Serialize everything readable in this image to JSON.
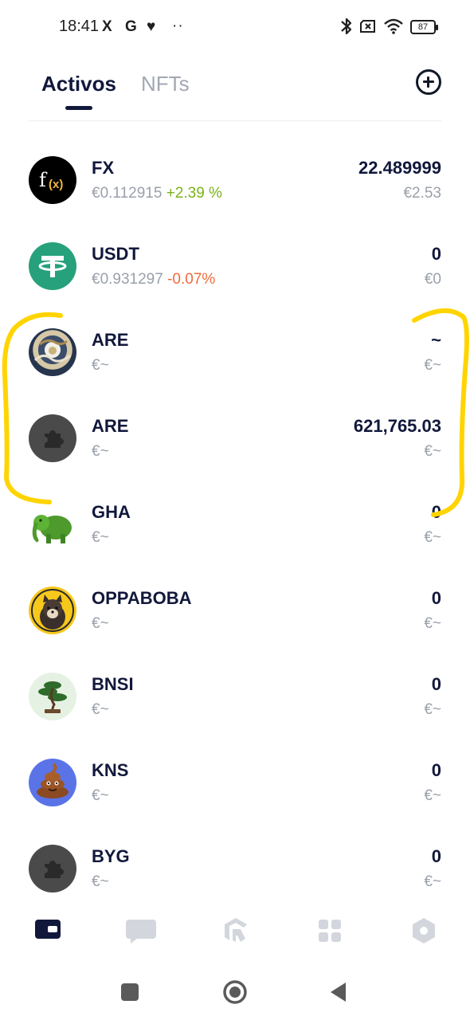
{
  "status_bar": {
    "time": "18:41",
    "x_icon": "X",
    "g_icon": "G",
    "heart_icon": "♥",
    "more": "··",
    "battery": "87",
    "icons": [
      "bluetooth-icon",
      "no-sim-icon",
      "wifi-icon",
      "battery-icon"
    ]
  },
  "tabs": [
    {
      "label": "Activos",
      "active": true
    },
    {
      "label": "NFTs",
      "active": false
    }
  ],
  "assets": [
    {
      "name": "FX",
      "price": "€0.112915",
      "change": "+2.39 %",
      "change_dir": "up",
      "balance": "22.489999",
      "value": "€2.53",
      "icon": "fx-logo-icon"
    },
    {
      "name": "USDT",
      "price": "€0.931297",
      "change": "-0.07%",
      "change_dir": "down",
      "balance": "0",
      "value": "€0",
      "icon": "tether-logo-icon"
    },
    {
      "name": "ARE",
      "price": "€~",
      "change": "",
      "change_dir": "",
      "balance": "~",
      "value": "€~",
      "icon": "dragon-art-icon"
    },
    {
      "name": "ARE",
      "price": "€~",
      "change": "",
      "change_dir": "",
      "balance": "621,765.03",
      "value": "€~",
      "icon": "puzzle-placeholder-icon"
    },
    {
      "name": "GHA",
      "price": "€~",
      "change": "",
      "change_dir": "",
      "balance": "0",
      "value": "€~",
      "icon": "green-elephant-icon"
    },
    {
      "name": "OPPABOBA",
      "price": "€~",
      "change": "",
      "change_dir": "",
      "balance": "0",
      "value": "€~",
      "icon": "dog-portrait-icon"
    },
    {
      "name": "BNSI",
      "price": "€~",
      "change": "",
      "change_dir": "",
      "balance": "0",
      "value": "€~",
      "icon": "bonsai-tree-icon"
    },
    {
      "name": "KNS",
      "price": "€~",
      "change": "",
      "change_dir": "",
      "balance": "0",
      "value": "€~",
      "icon": "poop-emoji-icon"
    },
    {
      "name": "BYG",
      "price": "€~",
      "change": "",
      "change_dir": "",
      "balance": "0",
      "value": "€~",
      "icon": "puzzle-placeholder-icon"
    }
  ],
  "bottom_nav": [
    {
      "icon": "wallet-icon",
      "active": true
    },
    {
      "icon": "chat-icon",
      "active": false
    },
    {
      "icon": "browser-logo-icon",
      "active": false
    },
    {
      "icon": "apps-grid-icon",
      "active": false
    },
    {
      "icon": "settings-hexagon-icon",
      "active": false
    }
  ],
  "colors": {
    "brand_dark": "#11183b",
    "positive": "#7ab317",
    "negative": "#f06b3d",
    "muted": "#9aa0ab",
    "annotation": "#ffd400"
  }
}
